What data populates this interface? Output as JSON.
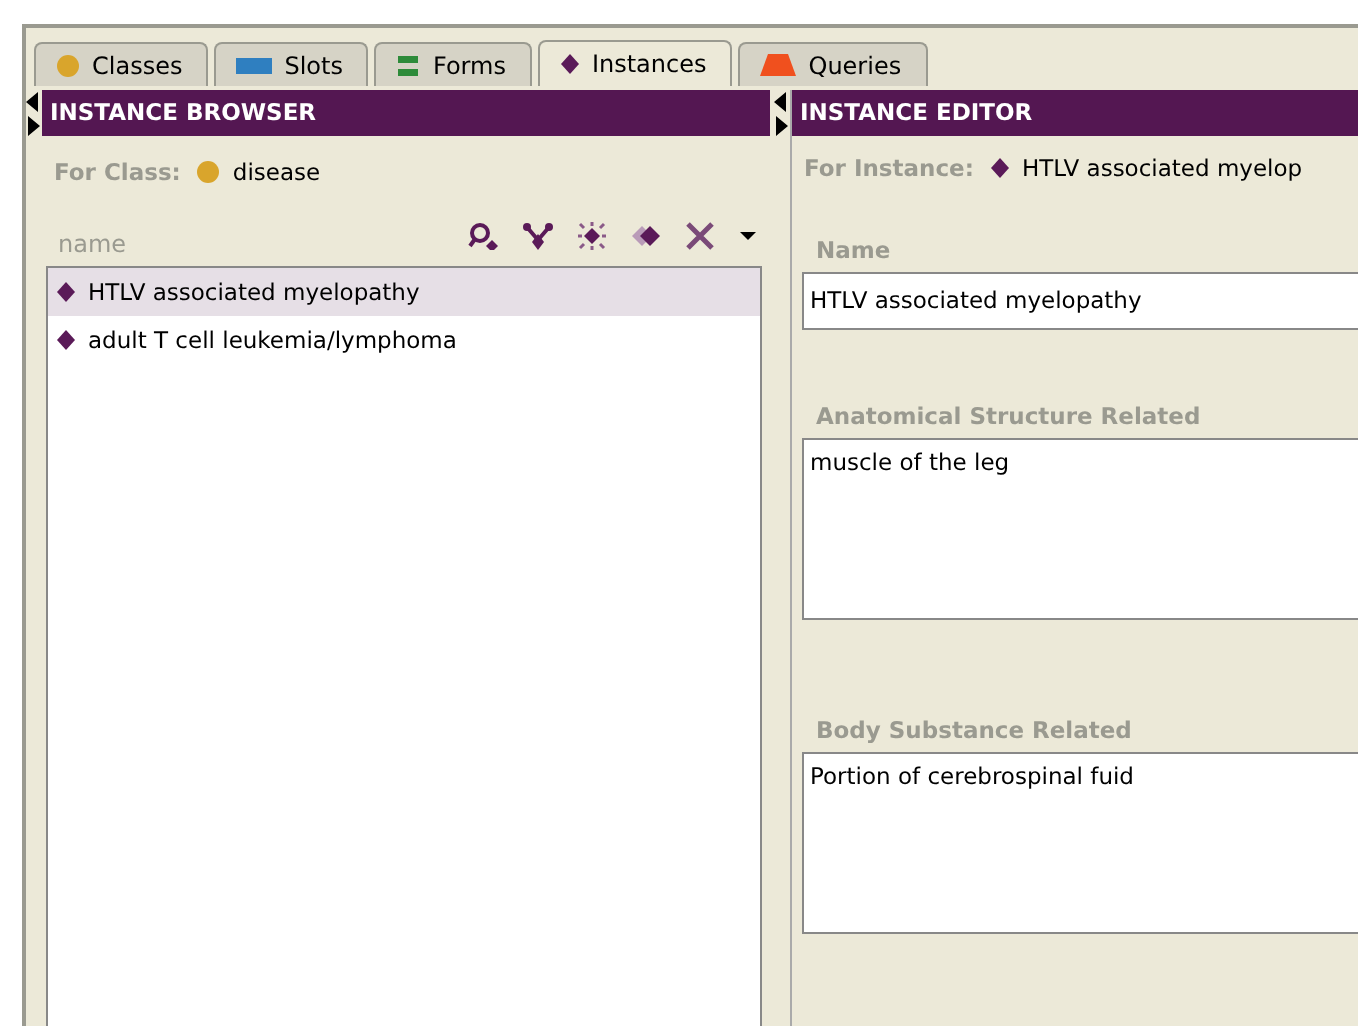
{
  "tabs": [
    {
      "label": "Classes",
      "kind": "dot",
      "selected": false
    },
    {
      "label": "Slots",
      "kind": "bar",
      "selected": false
    },
    {
      "label": "Forms",
      "kind": "lines",
      "selected": false
    },
    {
      "label": "Instances",
      "kind": "diamond",
      "selected": true
    },
    {
      "label": "Queries",
      "kind": "trapezoid",
      "selected": false
    }
  ],
  "instance_browser": {
    "title": "INSTANCE BROWSER",
    "for_label": "For Class:",
    "for_value": "disease",
    "column": "name",
    "items": [
      {
        "label": "HTLV associated myelopathy",
        "selected": true
      },
      {
        "label": "adult T cell leukemia/lymphoma",
        "selected": false
      }
    ]
  },
  "instance_editor": {
    "title": "INSTANCE EDITOR",
    "for_label": "For Instance:",
    "for_value": "HTLV associated myelop",
    "fields": [
      {
        "label": "Name",
        "value": "HTLV associated myelopathy",
        "kind": "line"
      },
      {
        "label": "Anatomical Structure Related",
        "value": "muscle of the leg",
        "kind": "area"
      },
      {
        "label": "Body Substance Related",
        "value": "Portion of cerebrospinal fuid",
        "kind": "area"
      }
    ]
  }
}
